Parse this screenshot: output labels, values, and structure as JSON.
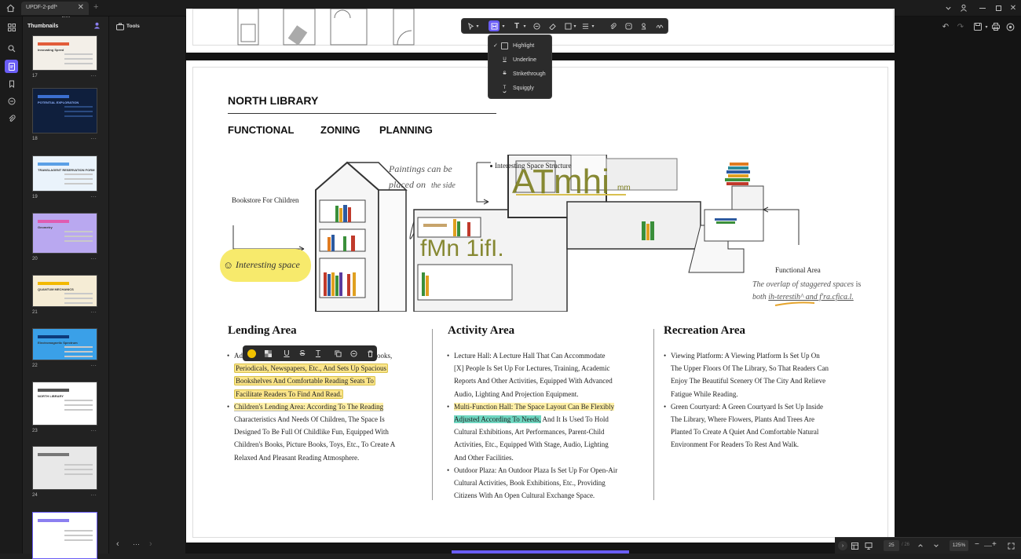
{
  "window": {
    "tab_title": "UPDF-2-pdf*",
    "tab_close": "✕",
    "new_tab": "+"
  },
  "thumbnails": {
    "title": "Thumbnails",
    "items": [
      {
        "page": "17",
        "color": "#f3efe8",
        "accent": "#e25c3a",
        "label": "Innovating Speed"
      },
      {
        "page": "18",
        "color": "#0f1f3d",
        "accent": "#3b6fd1",
        "label": "POTENTIAL EXPLORATION"
      },
      {
        "page": "19",
        "color": "#eaf3fb",
        "accent": "#5aa0e6",
        "label": "TRANSLAGENT RESERVATION FORM"
      },
      {
        "page": "20",
        "color": "#b9a8f0",
        "accent": "#e05bb1",
        "label": "Geometry"
      },
      {
        "page": "21",
        "color": "#f5ecd5",
        "accent": "#f2b800",
        "label": "QUANTUM MECHANICS"
      },
      {
        "page": "22",
        "color": "#3aa0e8",
        "accent": "#0d3a7a",
        "label": "Electromagnetic Spectrum"
      },
      {
        "page": "23",
        "color": "#ffffff",
        "accent": "#555555",
        "label": "NORTH LIBRARY"
      },
      {
        "page": "24",
        "color": "#e8e8e8",
        "accent": "#777777",
        "label": ""
      },
      {
        "page": "",
        "color": "#ffffff",
        "accent": "#8b7ff0",
        "label": ""
      }
    ],
    "menu_dots": "···"
  },
  "tools_label": "Tools",
  "annotation_menu": {
    "items": [
      {
        "label": "Highlight",
        "checked": true
      },
      {
        "label": "Underline",
        "checked": false
      },
      {
        "label": "Strikethrough",
        "checked": false
      },
      {
        "label": "Squiggly",
        "checked": false
      }
    ]
  },
  "document": {
    "title": "NORTH LIBRARY",
    "subtitle_words": [
      "FUNCTIONAL",
      "ZONING",
      "PLANNING"
    ],
    "illustration": {
      "paintings_note_1": "Paintings can be",
      "paintings_note_2": "placed on",
      "paintings_note_3": "the side",
      "interesting_structure": "Interesting Space Structure",
      "bookstore": "Bookstore For Children",
      "interesting_space": "Interesting space",
      "functional_area": "Functional Area",
      "overlay_text_1": "ATmhi",
      "overlay_text_1_suffix": "mm",
      "overlay_text_2": "fMn 1ifI.",
      "caption_1a": "The",
      "caption_1b": "overlap of staggered spaces",
      "caption_1c": "is",
      "caption_2a": "both",
      "caption_2b": "ih-terestih^ and f'ra.cfica.l."
    },
    "lending": {
      "heading": "Lending Area",
      "item1_prefix": "Ad",
      "item1_end": "Books,",
      "item1_lines": [
        "Periodicals, Newspapers, Etc., And Sets Up Spacious",
        "Bookshelves And Comfortable Reading Seats To",
        "Facilitate Readers To Find And Read."
      ],
      "item2_first": "Children's Lending Area: According To The Reading",
      "item2_lines": [
        "Characteristics And Needs Of Children, The Space Is",
        "Designed To Be Full Of Childlike Fun, Equipped With",
        "Children's Books, Picture Books, Toys, Etc., To Create A",
        "Relaxed And Pleasant Reading Atmosphere."
      ]
    },
    "activity": {
      "heading": "Activity Area",
      "item1_lines": [
        "Lecture Hall: A Lecture Hall That Can Accommodate",
        "[X] People Is Set Up For Lectures, Training, Academic",
        "Reports And Other Activities, Equipped With Advanced",
        "Audio, Lighting And Projection Equipment."
      ],
      "item2_first": "Multi-Function Hall: The Space Layout Can Be Flexibly",
      "item2_green": "Adjusted According To Needs,",
      "item2_rest": " And It Is Used To Hold",
      "item2_lines": [
        "Cultural Exhibitions, Art Performances, Parent-Child",
        "Activities, Etc., Equipped With Stage, Audio, Lighting",
        "And Other Facilities."
      ],
      "item3_lines": [
        "Outdoor Plaza: An Outdoor Plaza Is Set Up For Open-Air",
        "Cultural Activities, Book Exhibitions, Etc., Providing",
        "Citizens With An Open Cultural Exchange Space."
      ]
    },
    "recreation": {
      "heading": "Recreation Area",
      "item1_lines": [
        "Viewing Platform: A Viewing Platform Is Set Up On",
        "The Upper Floors Of The Library, So That Readers Can",
        "Enjoy The Beautiful Scenery Of The City And Relieve",
        "Fatigue While Reading."
      ],
      "item2_lines": [
        "Green Courtyard: A Green Courtyard Is Set Up Inside",
        "The Library, Where Flowers, Plants And Trees Are",
        "Planted To Create A Quiet And Comfortable Natural",
        "Environment For Readers To Rest And Walk."
      ]
    }
  },
  "bottom": {
    "page_current": "25",
    "page_total": "/ 26",
    "zoom": "125%",
    "minus": "−",
    "plus": "+"
  },
  "colors": {
    "accent": "#6a5df5",
    "highlight_yellow": "#fbe58a",
    "highlight_green": "#6fd6c0"
  }
}
